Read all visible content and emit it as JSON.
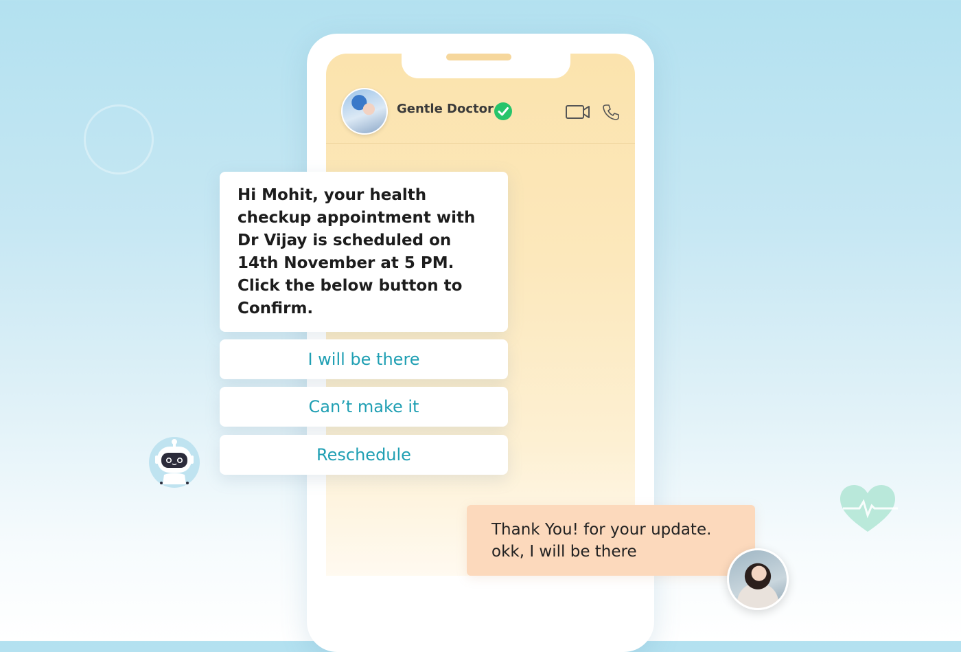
{
  "chat": {
    "contact_name": "Gentle Doctor",
    "verified_icon": "check-circle-icon",
    "header_icons": [
      "video-camera-icon",
      "phone-icon"
    ]
  },
  "bot_message": {
    "text": "Hi Mohit, your health checkup appointment with Dr Vijay is scheduled on 14th November at 5 PM.\nClick the below button to Confirm."
  },
  "quick_replies": [
    {
      "label": "I will be there"
    },
    {
      "label": "Can’t make it"
    },
    {
      "label": "Reschedule"
    }
  ],
  "user_message": {
    "text": "Thank You!  for your update.\nokk, I will be there"
  },
  "colors": {
    "reply_text": "#1f9fb3",
    "verified": "#27c46b",
    "user_bubble": "#fcd9bc",
    "screen": "#fbe3ad"
  }
}
